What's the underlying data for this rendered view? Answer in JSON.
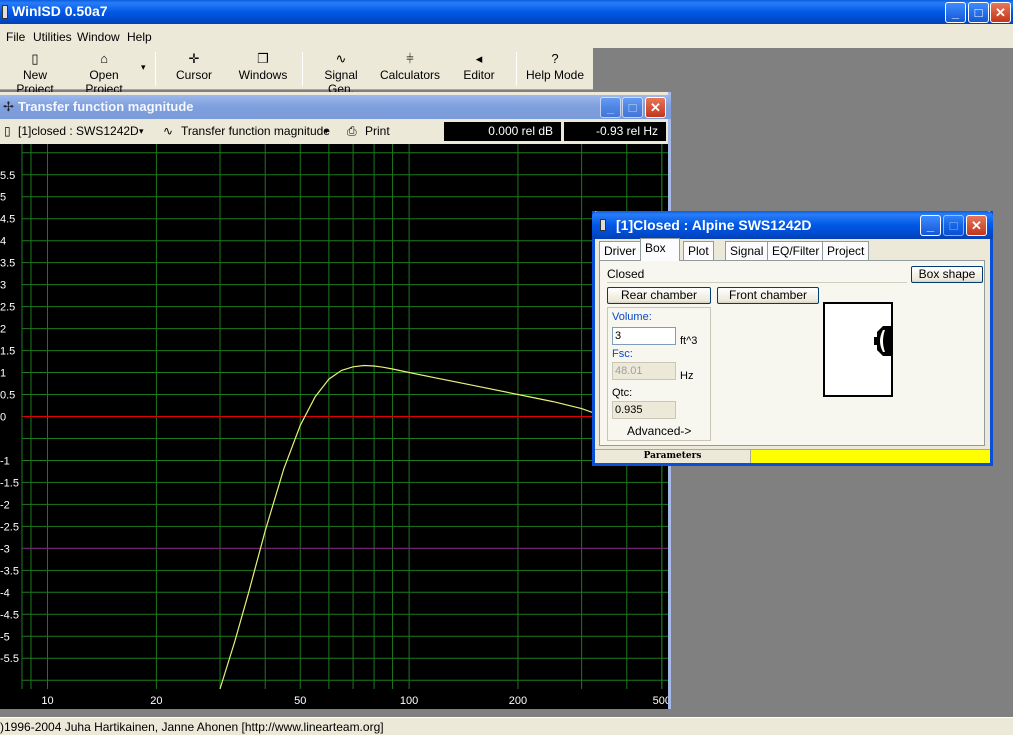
{
  "app": {
    "title": "WinISD 0.50a7",
    "min": "_",
    "max": "□",
    "close": "✕"
  },
  "menu": [
    "File",
    "Utilities",
    "Window",
    "Help"
  ],
  "toolbar": {
    "new_project": "New Project",
    "open_project": "Open Project",
    "cursor": "Cursor",
    "windows": "Windows",
    "signal_gen": "Signal Gen.",
    "calculators": "Calculators",
    "editor": "Editor",
    "help_mode": "Help Mode",
    "dropdown": "▾",
    "icons": {
      "new": "▯",
      "open": "⌂",
      "cursor": "✛",
      "windows": "❐",
      "signal": "∿",
      "calc": "⫩",
      "editor": "◂",
      "help": "?"
    }
  },
  "plot_window": {
    "title": "Transfer function magnitude",
    "pin": "✢",
    "project_select": "[1]closed : SWS1242D",
    "plot_select": "Transfer function magnitude",
    "print": "Print",
    "readout_db": "0.000 rel dB",
    "readout_hz": "-0.93 rel Hz",
    "dropdown": "▾",
    "plot_icon": "∿",
    "print_icon": "⎙",
    "proj_icon": "▯"
  },
  "chart_data": {
    "type": "line",
    "x_scale": "log",
    "xlim": [
      8.5,
      520
    ],
    "ylim": [
      -6.2,
      6.2
    ],
    "y_tick_labels": [
      "5.5",
      "5",
      "4.5",
      "4",
      "3.5",
      "3",
      "2.5",
      "2",
      "1.5",
      "1",
      "0.5",
      "0",
      "-1",
      "-1.5",
      "-2",
      "-2.5",
      "-3",
      "-3.5",
      "-4",
      "-4.5",
      "-5",
      "-5.5"
    ],
    "y_tick_values": [
      5.5,
      5,
      4.5,
      4,
      3.5,
      3,
      2.5,
      2,
      1.5,
      1,
      0.5,
      0,
      -1,
      -1.5,
      -2,
      -2.5,
      -3,
      -3.5,
      -4,
      -4.5,
      -5,
      -5.5
    ],
    "x_tick_labels": [
      "10",
      "20",
      "50",
      "100",
      "200",
      "500"
    ],
    "x_tick_values": [
      10,
      20,
      50,
      100,
      200,
      500
    ],
    "grid": true,
    "reference_lines": [
      {
        "y": 0,
        "color": "#e00000"
      },
      {
        "y": -3,
        "color": "#7a1f7a"
      }
    ],
    "series": [
      {
        "color": "#e8f07a",
        "x": [
          30,
          33,
          36,
          40,
          45,
          50,
          55,
          60,
          65,
          70,
          75,
          80,
          85,
          90,
          100,
          120,
          150,
          200,
          250,
          300,
          330
        ],
        "y": [
          -6.2,
          -5.1,
          -4.0,
          -2.6,
          -1.2,
          -0.2,
          0.45,
          0.85,
          1.05,
          1.13,
          1.16,
          1.15,
          1.12,
          1.08,
          1.0,
          0.87,
          0.71,
          0.5,
          0.34,
          0.18,
          0.06
        ]
      }
    ]
  },
  "dialog": {
    "title": "[1]Closed : Alpine SWS1242D",
    "tabs": [
      "Driver",
      "Box",
      "Plot",
      "Signal",
      "EQ/Filter",
      "Project"
    ],
    "box_type": "Closed",
    "box_shape_btn": "Box shape",
    "rear_chamber": "Rear chamber",
    "front_chamber": "Front chamber",
    "volume_label": "Volume:",
    "volume_value": "3",
    "volume_unit": "ft^3",
    "fsc_label": "Fsc:",
    "fsc_value": "48.01",
    "fsc_unit": "Hz",
    "qtc_label": "Qtc:",
    "qtc_value": "0.935",
    "advanced": "Advanced->",
    "status_parameters": "Parameters"
  },
  "status": {
    "copyright": ")1996-2004 Juha Hartikainen, Janne Ahonen [http://www.linearteam.org]"
  }
}
